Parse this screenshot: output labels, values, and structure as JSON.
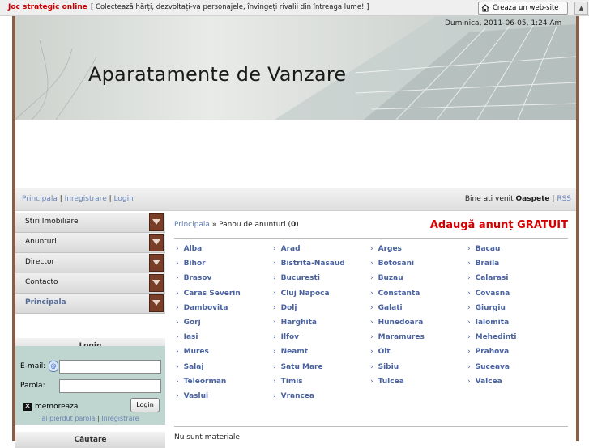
{
  "topbar": {
    "brand": "Joc strategic online",
    "slogan": "[ Colectează hărți, dezvoltați-va personajele, învingeți rivalii din întreaga lume! ]",
    "create_label": "Creaza un web-site"
  },
  "header": {
    "date": "Duminica, 2011-06-05, 1:24 Am",
    "title": "Aparatamente de Vanzare"
  },
  "nav": {
    "links": [
      "Principala",
      "Inregistrare",
      "Login"
    ],
    "greeting": "Bine ati venit",
    "user": "Oaspete",
    "rss": "RSS"
  },
  "sidebar": {
    "menu": [
      "Stiri Imobiliare",
      "Anunturi",
      "Director",
      "Contacto",
      "Principala"
    ],
    "login_title": "Login",
    "email_label": "E-mail:",
    "password_label": "Parola:",
    "remember_label": "memoreaza",
    "login_button": "Login",
    "forgot_link": "ai pierdut parola",
    "register_link": "Inregistrare",
    "search_title": "Căutare"
  },
  "main": {
    "crumb_home": "Principala",
    "crumb_sep": " » ",
    "crumb_page": "Panou de anunturi",
    "crumb_count": "0",
    "add_ad": "Adaugă anunț GRATUIT",
    "no_materials": "Nu sunt materiale",
    "regions": [
      [
        "Alba",
        "Arad",
        "Arges",
        "Bacau"
      ],
      [
        "Bihor",
        "Bistrita-Nasaud",
        "Botosani",
        "Braila"
      ],
      [
        "Brasov",
        "Bucuresti",
        "Buzau",
        "Calarasi"
      ],
      [
        "Caras Severin",
        "Cluj Napoca",
        "Constanta",
        "Covasna"
      ],
      [
        "Dambovita",
        "Dolj",
        "Galati",
        "Giurgiu"
      ],
      [
        "Gorj",
        "Harghita",
        "Hunedoara",
        "Ialomita"
      ],
      [
        "Iasi",
        "Ilfov",
        "Maramures",
        "Mehedinti"
      ],
      [
        "Mures",
        "Neamt",
        "Olt",
        "Prahova"
      ],
      [
        "Salaj",
        "Satu Mare",
        "Sibiu",
        "Suceava"
      ],
      [
        "Teleorman",
        "Timis",
        "Tulcea",
        "Valcea"
      ],
      [
        "Vaslui",
        "Vrancea"
      ]
    ]
  }
}
